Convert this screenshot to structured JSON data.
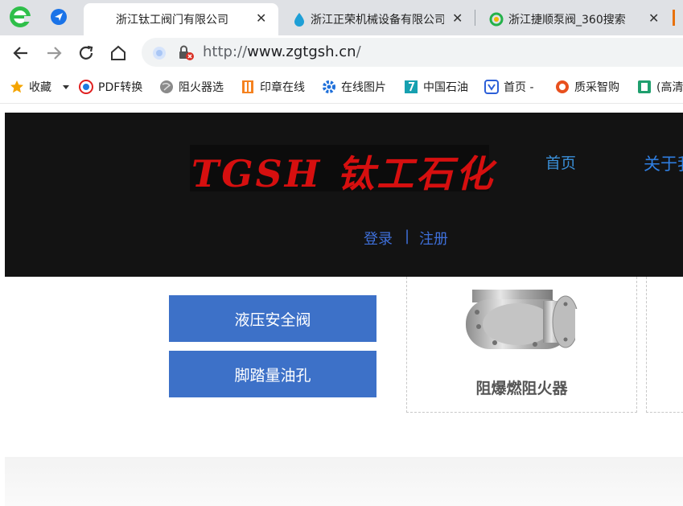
{
  "tabs": [
    {
      "title": "浙江钛工阀门有限公司",
      "active": true,
      "close": "✕"
    },
    {
      "title": "浙江正荣机械设备有限公司",
      "active": false,
      "close": "✕"
    },
    {
      "title": "浙江捷顺泵阀_360搜索",
      "active": false,
      "close": "✕"
    }
  ],
  "address_bar": {
    "scheme": "http://",
    "host": "www.zgtgsh.cn",
    "path": "/"
  },
  "bookmarks": [
    {
      "label": "收藏",
      "icon": "star-icon"
    },
    {
      "label": "PDF转换",
      "icon": "pdf-icon"
    },
    {
      "label": "阻火器选",
      "icon": "globe-icon"
    },
    {
      "label": "印章在线",
      "icon": "stamp-icon"
    },
    {
      "label": "在线图片",
      "icon": "gear-icon"
    },
    {
      "label": "中国石油",
      "icon": "petro-icon"
    },
    {
      "label": "首页 -",
      "icon": "home-site-icon"
    },
    {
      "label": "质采智购",
      "icon": "purchase-icon"
    },
    {
      "label": "(高清",
      "icon": "video-icon"
    }
  ],
  "site": {
    "logo_text": "TGSH 钛工石化",
    "nav": [
      "首页",
      "关于我"
    ],
    "login": "登录",
    "divider": "|",
    "register": "注册",
    "side_buttons": [
      "液压安全阀",
      "脚踏量油孔"
    ],
    "product_title": "阻爆燃阻火器"
  },
  "colors": {
    "hero_bg": "#131313",
    "logo_red": "#d60f0f",
    "button_blue": "#3d71c8",
    "nav_blue": "#3a8fd8"
  }
}
